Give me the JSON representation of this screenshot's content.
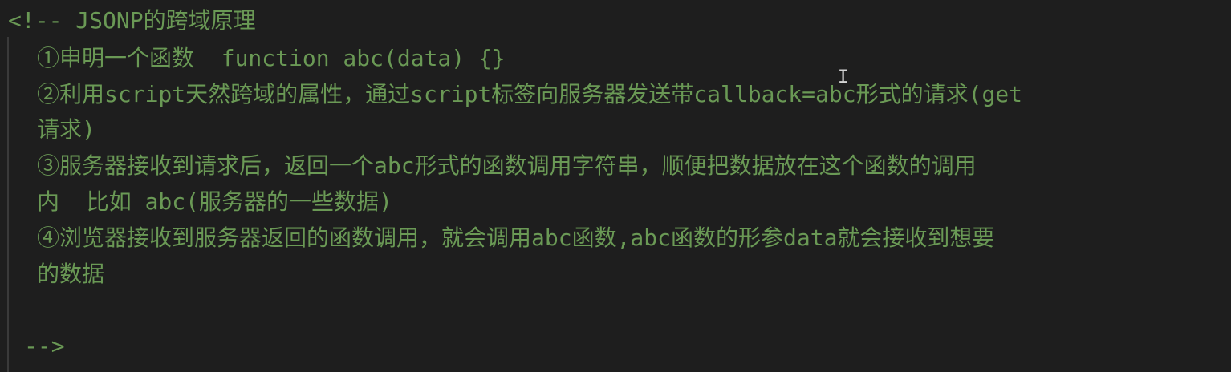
{
  "editor": {
    "comment_open": "<!-- JSONP的跨域原理",
    "lines": [
      "①申明一个函数  function abc(data) {}",
      "②利用script天然跨域的属性，通过script标签向服务器发送带callback=abc形式的请求(get",
      "请求)",
      "③服务器接收到请求后，返回一个abc形式的函数调用字符串，顺便把数据放在这个函数的调用",
      "内  比如 abc(服务器的一些数据)",
      "④浏览器接收到服务器返回的函数调用，就会调用abc函数,abc函数的形参data就会接收到想要",
      "的数据"
    ],
    "comment_close": "-->",
    "colors": {
      "background": "#1e1e1e",
      "comment_text": "#6a9955",
      "indent_guide": "#3a3a3a"
    }
  }
}
